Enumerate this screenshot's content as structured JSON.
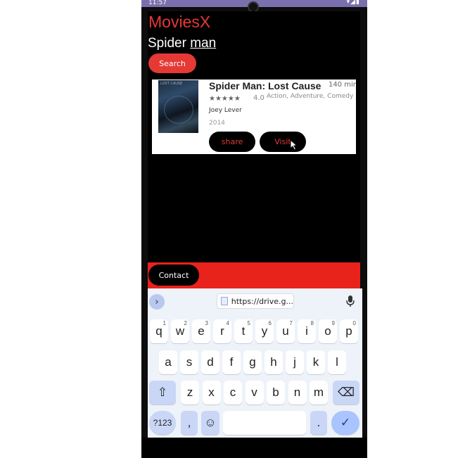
{
  "statusbar": {
    "time": "11:57",
    "icons": "▾◢▮"
  },
  "app": {
    "title": "MoviesX",
    "search_text_plain": "Spider ",
    "search_text_underlined": "man",
    "search_button": "Search"
  },
  "movie": {
    "title": "Spider Man: Lost Cause",
    "runtime": "140 min",
    "stars": "★★★★★",
    "rating": "4.0",
    "genres": "Action, Adventure, Comedy",
    "director": "Joey Lever",
    "year": "2014",
    "poster_text": "LOST CAUSE",
    "share_button": "share",
    "visit_button": "Visit"
  },
  "footer": {
    "contact_button": "Contact"
  },
  "keyboard": {
    "url": "https://drive.g...",
    "row1": [
      {
        "k": "q",
        "s": "1"
      },
      {
        "k": "w",
        "s": "2"
      },
      {
        "k": "e",
        "s": "3"
      },
      {
        "k": "r",
        "s": "4"
      },
      {
        "k": "t",
        "s": "5"
      },
      {
        "k": "y",
        "s": "6"
      },
      {
        "k": "u",
        "s": "7"
      },
      {
        "k": "i",
        "s": "8"
      },
      {
        "k": "o",
        "s": "9"
      },
      {
        "k": "p",
        "s": "0"
      }
    ],
    "row2": [
      "a",
      "s",
      "d",
      "f",
      "g",
      "h",
      "j",
      "k",
      "l"
    ],
    "row3": [
      "z",
      "x",
      "c",
      "v",
      "b",
      "n",
      "m"
    ],
    "sym_key": "?123",
    "comma": ",",
    "period": ".",
    "shift_icon": "⇧",
    "backspace_icon": "⌫",
    "emoji_icon": "☺",
    "enter_icon": "✓",
    "chevron_icon": "›",
    "mic_icon": "🎙"
  }
}
